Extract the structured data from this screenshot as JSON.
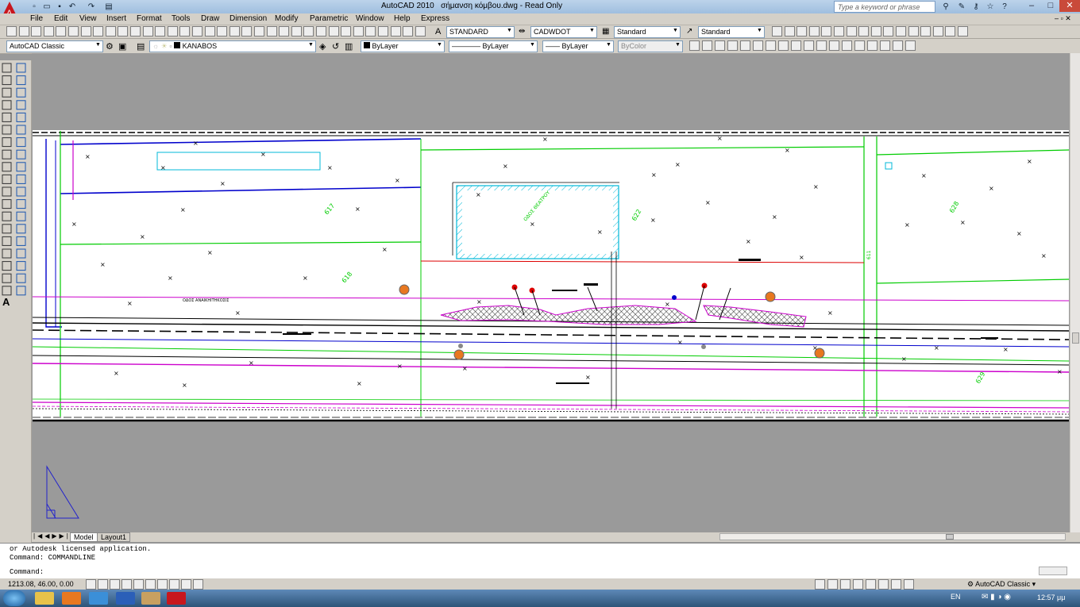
{
  "window": {
    "title": "AutoCAD 2010",
    "document": "σήμανση κόμβου.dwg - Read Only",
    "search_placeholder": "Type a keyword or phrase",
    "controls": [
      "–",
      "□",
      "✕"
    ]
  },
  "menu": [
    "File",
    "Edit",
    "View",
    "Insert",
    "Format",
    "Tools",
    "Draw",
    "Dimension",
    "Modify",
    "Parametric",
    "Window",
    "Help",
    "Express"
  ],
  "toolbar": {
    "text_style": "STANDARD",
    "dim_style": "CADWDOT",
    "table_style": "Standard",
    "multileader_style": "Standard",
    "workspace": "AutoCAD Classic",
    "layer": "KANABOS",
    "color": "ByLayer",
    "linetype": "ByLayer",
    "lineweight": "ByLayer",
    "plotstyle": "ByColor"
  },
  "drawing": {
    "labels": [
      "ΟΔΟΣ ΑΝΑΙΚΗΙΤΗΚΟΣΙΣ",
      "ΟΔΟΣ ΘΕΑΤΡΟΥ",
      "622",
      "611",
      "617",
      "618",
      "628",
      "629"
    ],
    "colors": {
      "background": "#ffffff",
      "green": "#00cc00",
      "blue": "#0000cc",
      "magenta": "#cc00cc",
      "cyan": "#00b8d8",
      "red": "#dd0000",
      "orange": "#e87820"
    }
  },
  "tabs": [
    "Model",
    "Layout1"
  ],
  "command": {
    "history": [
      "or Autodesk licensed application.",
      "Command: COMMANDLINE"
    ],
    "prompt": "Command:"
  },
  "status": {
    "coordinates": "1213.08, 46.00, 0.00",
    "workspace": "AutoCAD Classic"
  },
  "taskbar": {
    "language": "EN",
    "time": "12:57 μμ"
  }
}
